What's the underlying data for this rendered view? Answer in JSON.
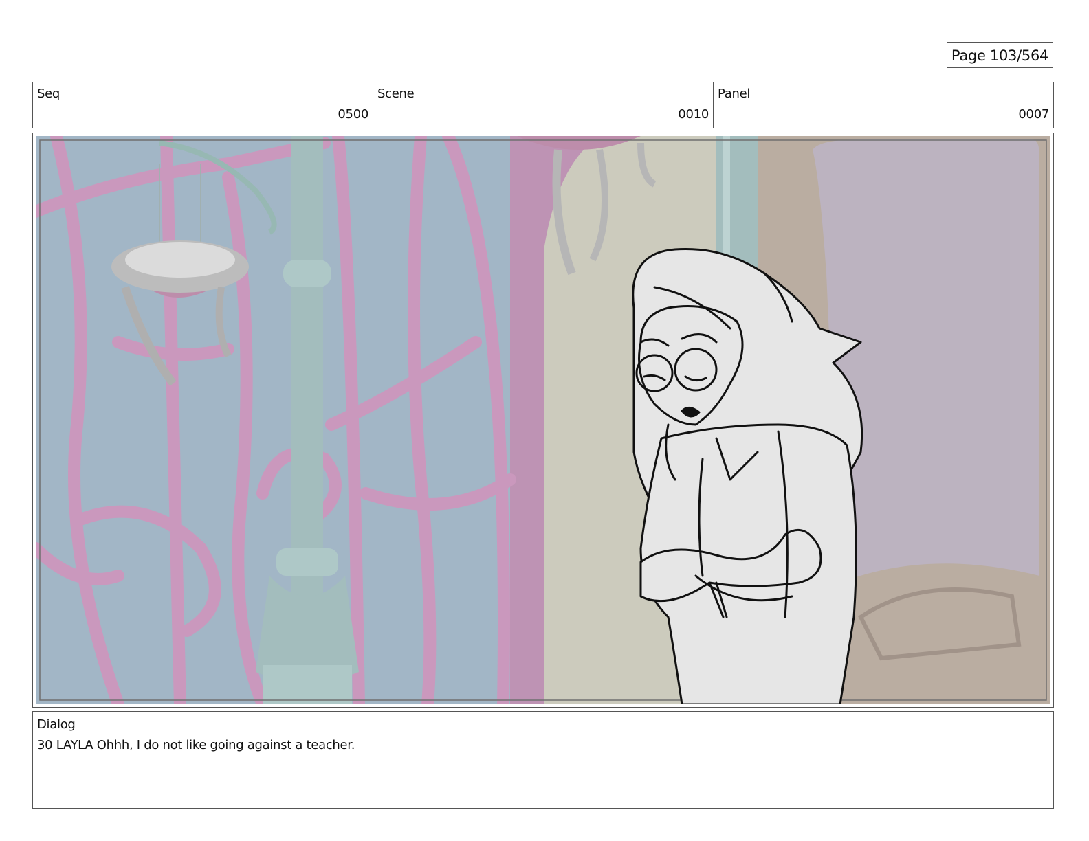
{
  "page": {
    "number_label": "Page 103/564"
  },
  "header": {
    "seq": {
      "label": "Seq",
      "value": "0500"
    },
    "scene": {
      "label": "Scene",
      "value": "0010"
    },
    "panel": {
      "label": "Panel",
      "value": "0007"
    }
  },
  "frame": {
    "colors": {
      "sky": "#9bb0c2",
      "railing": "#c690b8",
      "column": "#9cb8b8",
      "wall": "#c8c7b8",
      "door_frame": "#b5a79a",
      "door_inner": "#b7adbb",
      "sketch_fill": "#e6e6e6",
      "sketch_line": "#111111"
    }
  },
  "dialog": {
    "label": "Dialog",
    "text": "30 LAYLA Ohhh, I do not like going against a teacher."
  }
}
